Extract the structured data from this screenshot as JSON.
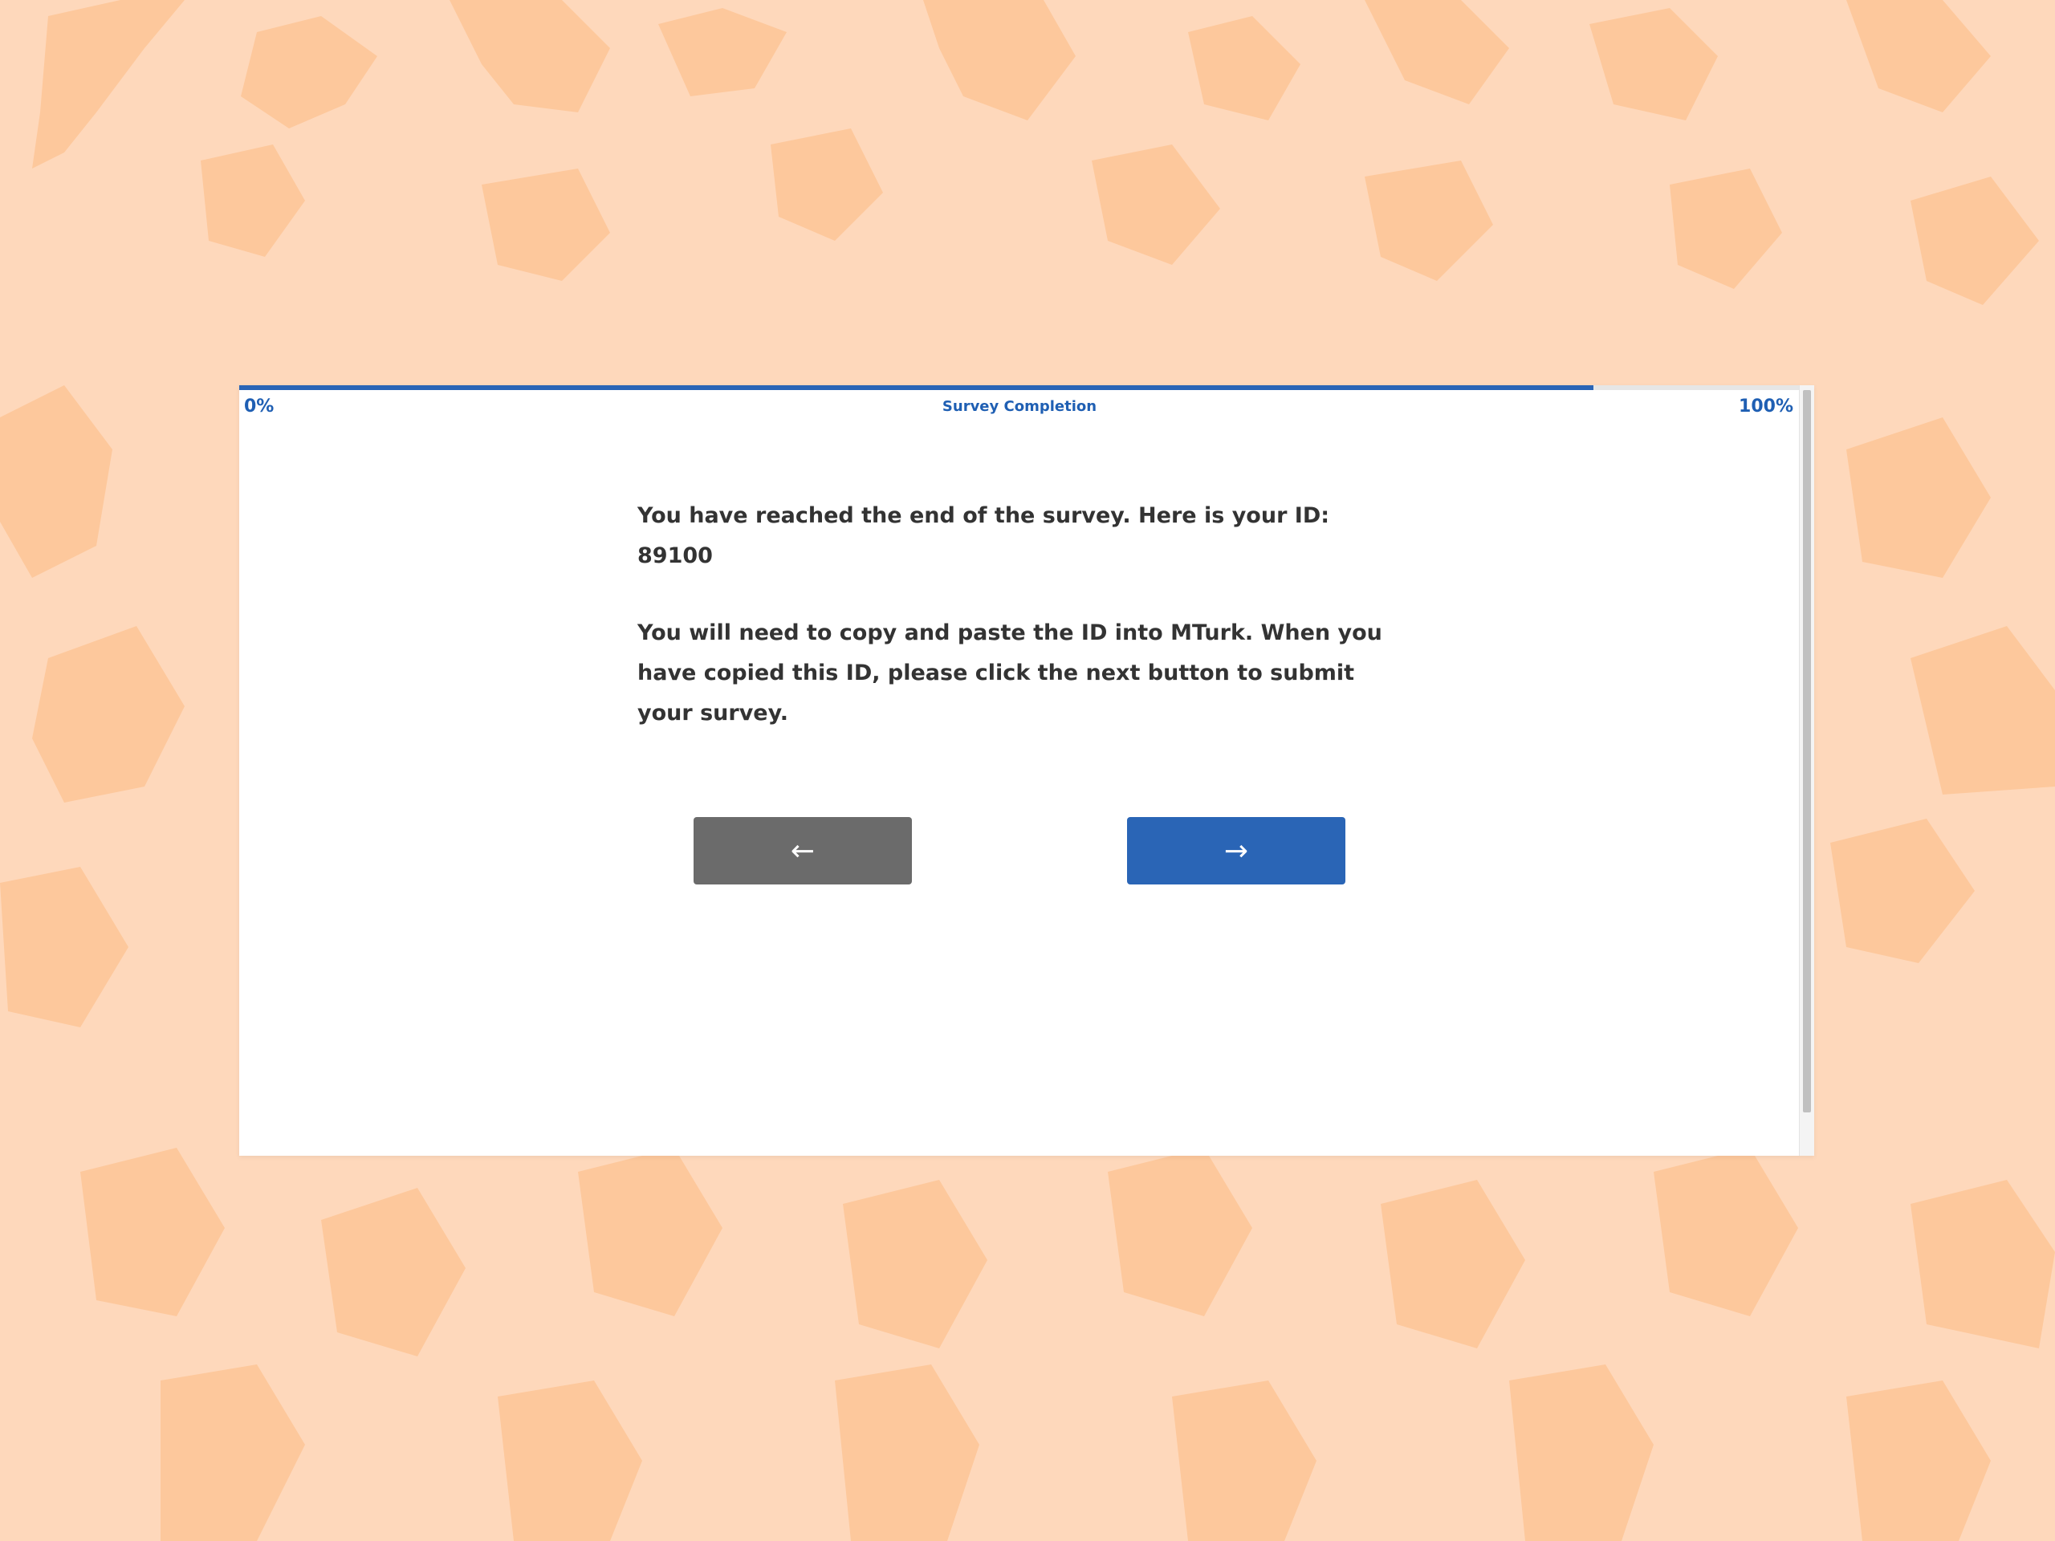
{
  "progress": {
    "label_start": "0%",
    "label_end": "100%",
    "title": "Survey Completion",
    "fraction_complete": 0.86,
    "color": "#2a65b6"
  },
  "content": {
    "paragraph_1": "You have reached the end of the survey. Here is your ID: 89100",
    "paragraph_2": "You will need to copy and paste the ID into MTurk. When you have copied this ID, please click the next button to submit your survey."
  },
  "nav": {
    "back_label": "←",
    "next_label": "→",
    "back_color": "#6b6b6b",
    "next_color": "#2a65b6"
  },
  "colors": {
    "background": "#fed8bb",
    "pattern": "#fdc89c"
  }
}
